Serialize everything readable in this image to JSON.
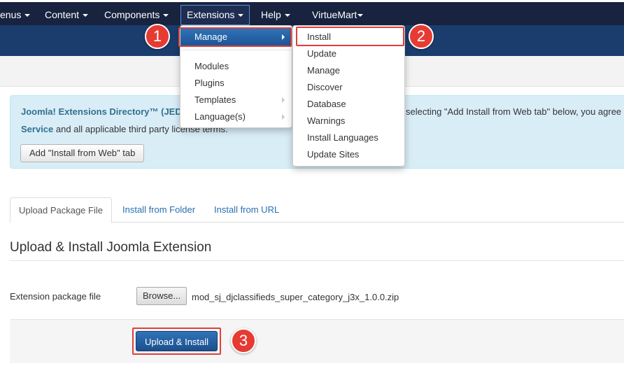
{
  "navbar": {
    "items": [
      {
        "label": "enus"
      },
      {
        "label": "Content"
      },
      {
        "label": "Components"
      },
      {
        "label": "Extensions"
      },
      {
        "label": "Help"
      },
      {
        "label": "VirtueMart"
      }
    ]
  },
  "extensions_menu": {
    "items": [
      {
        "label": "Manage"
      },
      {
        "label": "Modules"
      },
      {
        "label": "Plugins"
      },
      {
        "label": "Templates"
      },
      {
        "label": "Language(s)"
      }
    ]
  },
  "manage_submenu": {
    "items": [
      {
        "label": "Install"
      },
      {
        "label": "Update"
      },
      {
        "label": "Manage"
      },
      {
        "label": "Discover"
      },
      {
        "label": "Database"
      },
      {
        "label": "Warnings"
      },
      {
        "label": "Install Languages"
      },
      {
        "label": "Update Sites"
      }
    ]
  },
  "alert": {
    "line1_start": "Joomla! Extensions Directory™ (JED",
    "line1_end": "selecting \"Add Install from Web tab\" below, you agree",
    "line2_bold": "Service",
    "line2_rest": " and all applicable third party license terms.",
    "button_label": "Add \"Install from Web\" tab"
  },
  "tabs": [
    {
      "label": "Upload Package File"
    },
    {
      "label": "Install from Folder"
    },
    {
      "label": "Install from URL"
    }
  ],
  "section_title": "Upload & Install Joomla Extension",
  "form": {
    "field_label": "Extension package file",
    "browse_label": "Browse...",
    "file_name": "mod_sj_djclassifieds_super_category_j3x_1.0.0.zip",
    "submit_label": "Upload & Install"
  },
  "callouts": [
    "1",
    "2",
    "3"
  ],
  "colors": {
    "navbar": "#17233f",
    "subheader": "#1a3d6e",
    "alert_bg": "#d9edf7",
    "primary": "#2f73b8",
    "callout": "#e53b33"
  }
}
